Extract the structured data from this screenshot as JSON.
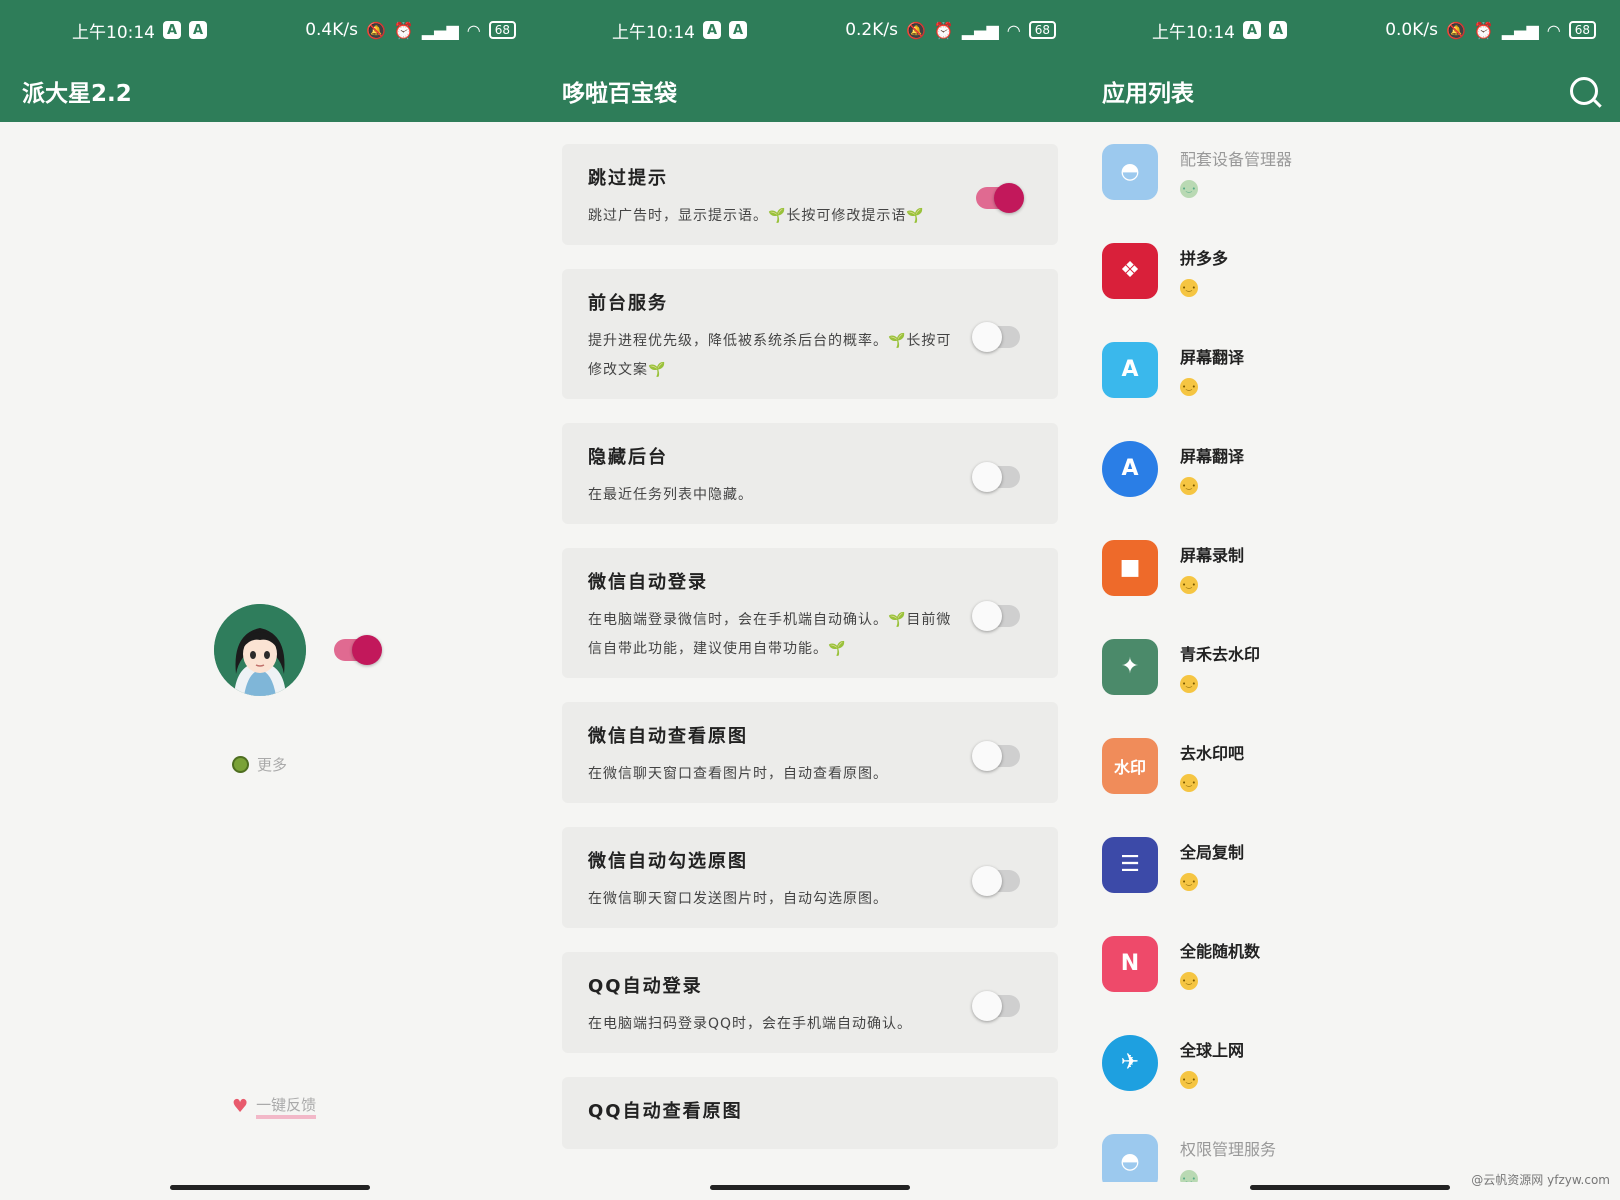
{
  "status_bars": [
    {
      "time": "上午10:14",
      "speed": "0.4K/s",
      "battery": "68"
    },
    {
      "time": "上午10:14",
      "speed": "0.2K/s",
      "battery": "68"
    },
    {
      "time": "上午10:14",
      "speed": "0.0K/s",
      "battery": "68"
    }
  ],
  "panel1": {
    "title": "派大星2.2",
    "main_switch_on": true,
    "more_label": "更多",
    "feedback_label": "一键反馈"
  },
  "panel2": {
    "title": "哆啦百宝袋",
    "cards": [
      {
        "title": "跳过提示",
        "desc": "跳过广告时，显示提示语。🌱长按可修改提示语🌱",
        "on": true
      },
      {
        "title": "前台服务",
        "desc": "提升进程优先级，降低被系统杀后台的概率。🌱长按可修改文案🌱",
        "on": false
      },
      {
        "title": "隐藏后台",
        "desc": "在最近任务列表中隐藏。",
        "on": false
      },
      {
        "title": "微信自动登录",
        "desc": "在电脑端登录微信时，会在手机端自动确认。🌱目前微信自带此功能，建议使用自带功能。🌱",
        "on": false
      },
      {
        "title": "微信自动查看原图",
        "desc": "在微信聊天窗口查看图片时，自动查看原图。",
        "on": false
      },
      {
        "title": "微信自动勾选原图",
        "desc": "在微信聊天窗口发送图片时，自动勾选原图。",
        "on": false
      },
      {
        "title": "QQ自动登录",
        "desc": "在电脑端扫码登录QQ时，会在手机端自动确认。",
        "on": false
      },
      {
        "title": "QQ自动查看原图",
        "desc": "",
        "on": false
      }
    ]
  },
  "panel3": {
    "title": "应用列表",
    "apps": [
      {
        "name": "配套设备管理器",
        "icon": "android-icon",
        "color": "#9cc9ee",
        "dim": true
      },
      {
        "name": "拼多多",
        "icon": "pinduoduo-icon",
        "color": "#d9203a",
        "dim": false
      },
      {
        "name": "屏幕翻译",
        "icon": "translate-icon",
        "color": "#3ab8ec",
        "dim": false
      },
      {
        "name": "屏幕翻译",
        "icon": "translate-circle-icon",
        "color": "#2a7ee6",
        "dim": false
      },
      {
        "name": "屏幕录制",
        "icon": "video-camera-icon",
        "color": "#ee6a2a",
        "dim": false
      },
      {
        "name": "青禾去水印",
        "icon": "sprout-icon",
        "color": "#4b8a6a",
        "dim": false
      },
      {
        "name": "去水印吧",
        "icon": "watermark-icon",
        "color": "#f08c5a",
        "dim": false
      },
      {
        "name": "全局复制",
        "icon": "copy-icon",
        "color": "#3c4aa8",
        "dim": false
      },
      {
        "name": "全能随机数",
        "icon": "random-n-icon",
        "color": "#ee4a6a",
        "dim": false
      },
      {
        "name": "全球上网",
        "icon": "globe-plane-icon",
        "color": "#1ea0e0",
        "dim": false
      },
      {
        "name": "权限管理服务",
        "icon": "android-icon",
        "color": "#9cc9ee",
        "dim": true
      }
    ]
  },
  "watermark": "@云帆资源网 yfzyw.com",
  "colors": {
    "primary": "#2e7d59",
    "accent": "#c2185b"
  }
}
